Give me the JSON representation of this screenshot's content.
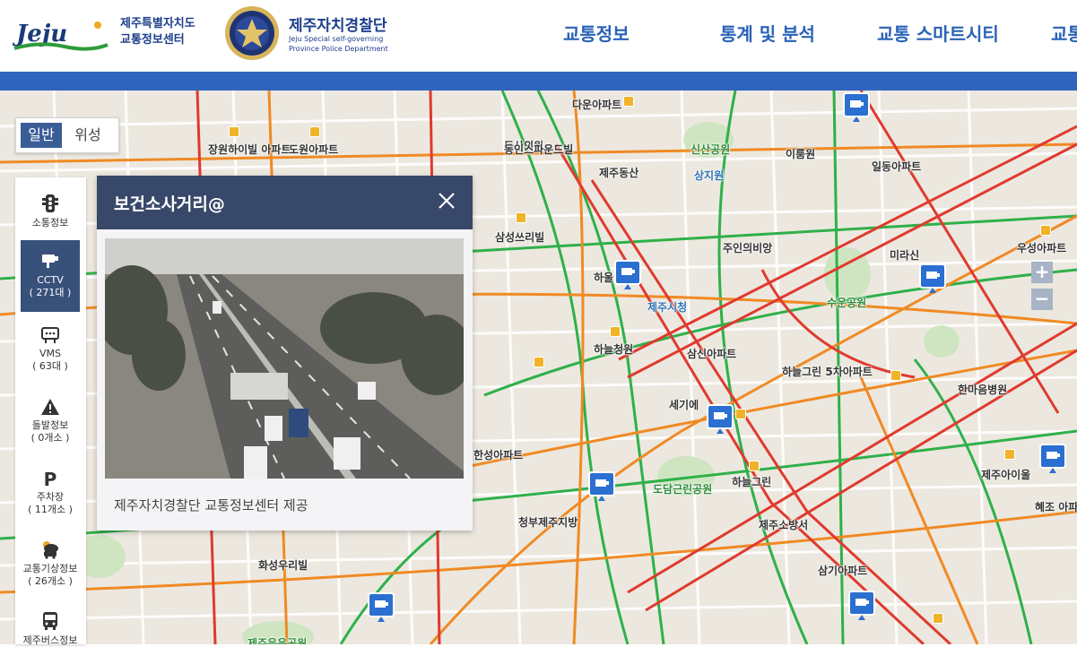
{
  "header": {
    "jeju_logo_text": "Jeju",
    "jeju_sub_line1": "제주특별자치도",
    "jeju_sub_line2": "교통정보센터",
    "police_title": "제주자치경찰단",
    "police_en_line1": "Jeju Special self-governing",
    "police_en_line2": "Province Police Department",
    "nav": [
      "교통정보",
      "통계 및 분석",
      "교통 스마트시티",
      "교통"
    ]
  },
  "map_type": {
    "active": "일반",
    "inactive": "위성"
  },
  "sidepanel": {
    "items": [
      {
        "label": "소통정보",
        "count": "",
        "icon": "traffic-light-icon"
      },
      {
        "label": "CCTV",
        "count": "( 271대 )",
        "icon": "cctv-icon"
      },
      {
        "label": "VMS",
        "count": "( 63대 )",
        "icon": "vms-icon"
      },
      {
        "label": "돌발정보",
        "count": "( 0개소 )",
        "icon": "warning-icon"
      },
      {
        "label": "주차장",
        "count": "( 11개소 )",
        "icon": "parking-icon"
      },
      {
        "label": "교통기상정보",
        "count": "( 26개소 )",
        "icon": "weather-icon"
      },
      {
        "label": "제주버스정보",
        "count": "",
        "icon": "bus-icon"
      }
    ]
  },
  "popup": {
    "title": "보건소사거리@",
    "footer": "제주자치경찰단 교통정보센터 제공",
    "close_icon": "close-icon"
  },
  "zoom": {
    "in": "+",
    "out": "−"
  },
  "map_labels": [
    "다운아파트",
    "동산의원",
    "장원하이빌 아파트",
    "도원아파트",
    "동인스파운드빌",
    "제주동산",
    "신산공원",
    "이룸원",
    "일동아파트",
    "삼성쓰리빌",
    "주인의비앙",
    "하울",
    "제주시청",
    "수운공원",
    "미라신",
    "우성아파트",
    "하늘청원",
    "삼신아파트",
    "하늘그린 5차아파트",
    "세기에",
    "한마음병원",
    "한성아파트",
    "하늘그린",
    "도담근린공원",
    "제주소방서",
    "청부제주지방",
    "제주아이울",
    "혜조 아파트",
    "화성우리빌",
    "제주응음공원",
    "삼기아파트",
    "상지원"
  ],
  "colors": {
    "header_blue": "#2f64bf",
    "nav_text": "#2a62b6",
    "popup_head": "#38486a",
    "side_active": "#38517a",
    "road_red": "#e03a2f",
    "road_green": "#2fb04a",
    "road_orange": "#f08a24"
  }
}
